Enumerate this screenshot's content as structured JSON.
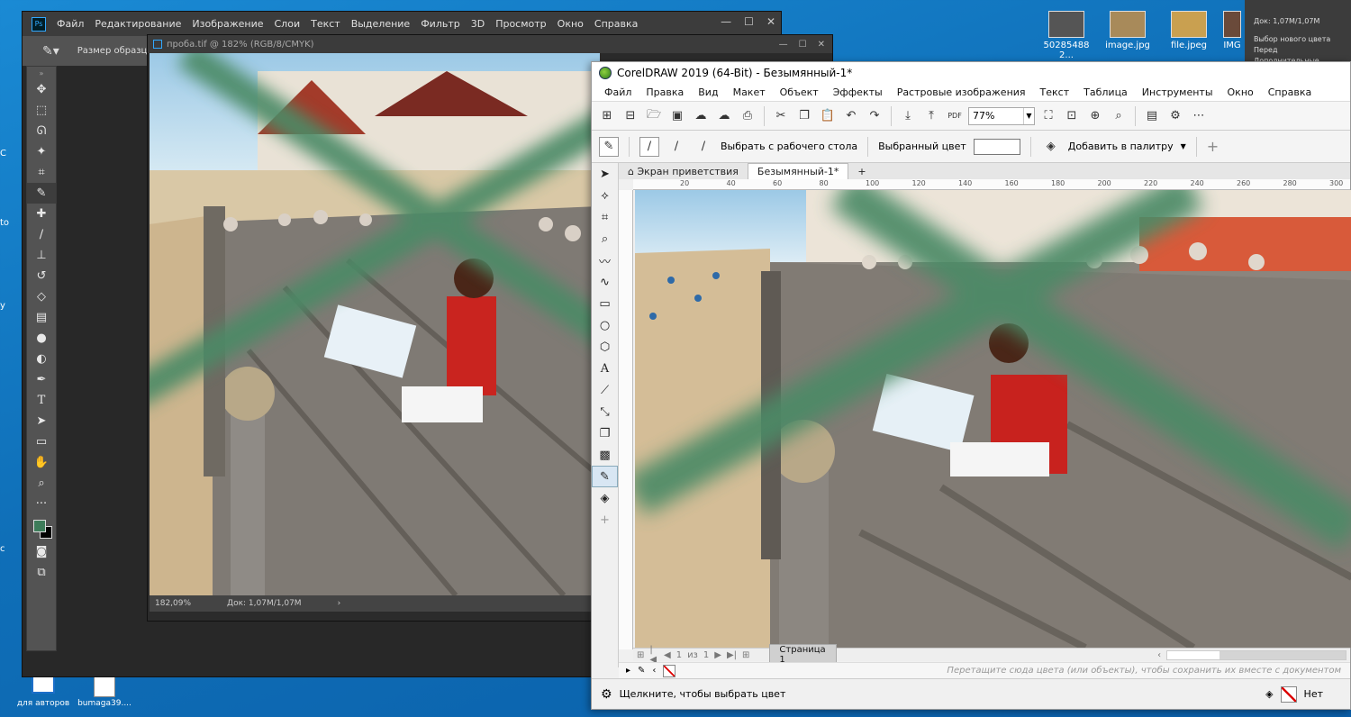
{
  "desktop": {
    "icons": [
      {
        "label": "50285488 2..."
      },
      {
        "label": "image.jpg"
      },
      {
        "label": "file.jpeg"
      },
      {
        "label": "IMG"
      }
    ],
    "bottom_icons": [
      {
        "label": "для авторов"
      },
      {
        "label": "bumaga39...."
      }
    ],
    "left_edge_texts": [
      "C",
      "to",
      "y",
      "c"
    ]
  },
  "info_panel": {
    "doc": "Док: 1,07М/1,07М",
    "line1": "Выбор нового цвета Перед",
    "line2": "Дополнительные возмож"
  },
  "photoshop": {
    "logo": "Ps",
    "menu": [
      "Файл",
      "Редактирование",
      "Изображение",
      "Слои",
      "Текст",
      "Выделение",
      "Фильтр",
      "3D",
      "Просмотр",
      "Окно",
      "Справка"
    ],
    "options_label": "Размер образца:",
    "doc_title": "проба.tif @ 182% (RGB/8/CMYK)",
    "status_zoom": "182,09%",
    "status_doc": "Док: 1,07М/1,07М",
    "colors": {
      "foreground": "#3e7c5a",
      "background": "#000000"
    }
  },
  "corel": {
    "title": "CorelDRAW 2019 (64-Bit) - Безымянный-1*",
    "menu": [
      "Файл",
      "Правка",
      "Вид",
      "Макет",
      "Объект",
      "Эффекты",
      "Растровые изображения",
      "Текст",
      "Таблица",
      "Инструменты",
      "Окно",
      "Справка"
    ],
    "zoom": "77%",
    "prop_pick": "Выбрать с рабочего стола",
    "prop_selected_color": "Выбранный цвет",
    "prop_add_palette": "Добавить в палитру",
    "tabs": [
      "Экран приветствия",
      "Безымянный-1*"
    ],
    "ruler_ticks": [
      "20",
      "40",
      "60",
      "80",
      "100",
      "120",
      "140",
      "160",
      "180",
      "200",
      "220",
      "240",
      "260",
      "280",
      "300"
    ],
    "pager": {
      "current": "1",
      "of": "из",
      "total": "1",
      "page_tab": "Страница 1"
    },
    "palette_hint": "Перетащите сюда цвета (или объекты), чтобы сохранить их вместе с документом",
    "status_left": "Щелкните, чтобы выбрать цвет",
    "status_right": "Нет"
  }
}
